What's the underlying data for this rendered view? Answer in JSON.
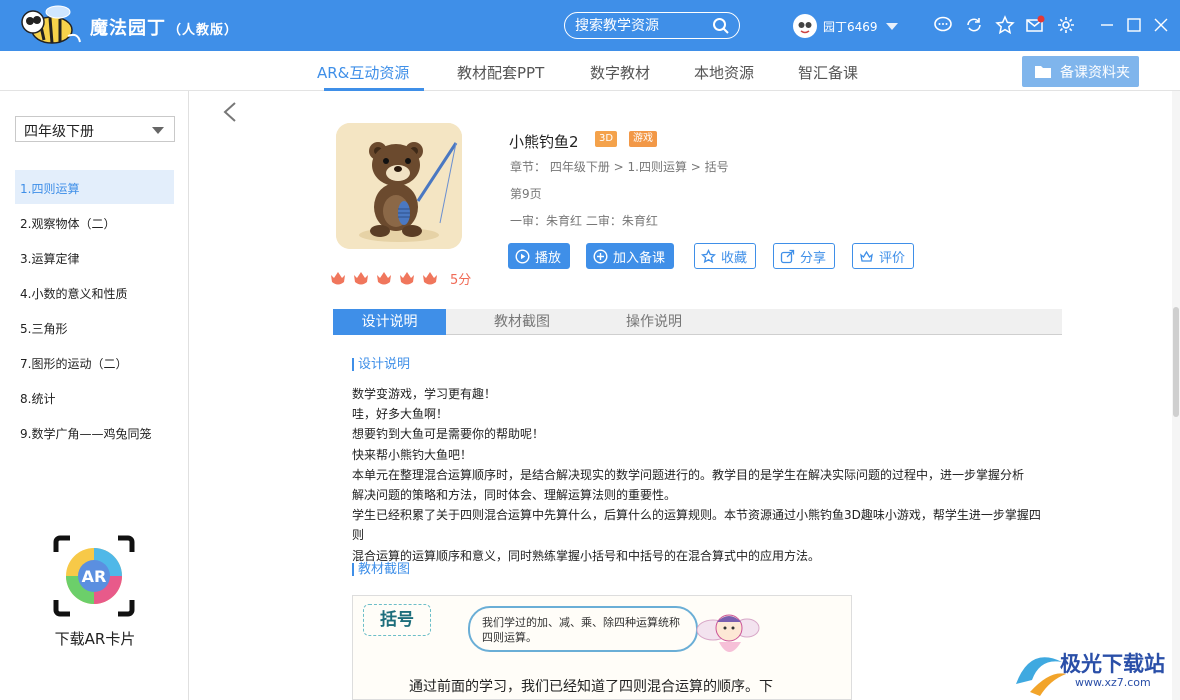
{
  "app": {
    "title": "魔法园丁",
    "edition": "（人教版）"
  },
  "search": {
    "placeholder": "搜索教学资源"
  },
  "user": {
    "name": "园丁6469"
  },
  "colors": {
    "primary": "#3f8fe8",
    "badge_orange": "#f4a24b",
    "score_red": "#f06b57"
  },
  "topnav": {
    "tabs": [
      {
        "label": "AR&互动资源",
        "active": true
      },
      {
        "label": "教材配套PPT",
        "active": false
      },
      {
        "label": "数字教材",
        "active": false
      },
      {
        "label": "本地资源",
        "active": false
      },
      {
        "label": "智汇备课",
        "active": false
      }
    ],
    "folder_button": "备课资料夹"
  },
  "sidebar": {
    "grade": "四年级下册",
    "units": [
      {
        "label": "1.四则运算",
        "active": true
      },
      {
        "label": "2.观察物体（二）",
        "active": false
      },
      {
        "label": "3.运算定律",
        "active": false
      },
      {
        "label": "4.小数的意义和性质",
        "active": false
      },
      {
        "label": "5.三角形",
        "active": false
      },
      {
        "label": "7.图形的运动（二）",
        "active": false
      },
      {
        "label": "8.统计",
        "active": false
      },
      {
        "label": "9.数学广角——鸡兔同笼",
        "active": false
      }
    ],
    "ar_card_label": "下载AR卡片",
    "ar_card_text": "AR"
  },
  "resource": {
    "title": "小熊钓鱼2",
    "badges": [
      "3D",
      "游戏"
    ],
    "chapter": "章节：   四年级下册 > 1.四则运算 > 括号",
    "page": "第9页",
    "review": "一审：朱育红      二审：朱育红",
    "rating_stars": 5,
    "score": "5分",
    "actions": {
      "play": "播放",
      "add": "加入备课",
      "favorite": "收藏",
      "share": "分享",
      "review": "评价"
    }
  },
  "detail_tabs": [
    {
      "label": "设计说明",
      "active": true
    },
    {
      "label": "教材截图",
      "active": false
    },
    {
      "label": "操作说明",
      "active": false
    }
  ],
  "design": {
    "heading": "设计说明",
    "lines": [
      "数学变游戏，学习更有趣！",
      "哇，好多大鱼啊！",
      "想要钓到大鱼可是需要你的帮助呢！",
      "快来帮小熊钓大鱼吧！",
      "本单元在整理混合运算顺序时，是结合解决现实的数学问题进行的。教学目的是学生在解决实际问题的过程中，进一步掌握分析",
      "解决问题的策略和方法，同时体会、理解运算法则的重要性。",
      "学生已经积累了关于四则混合运算中先算什么，后算什么的运算规则。本节资源通过小熊钓鱼3D趣味小游戏，帮学生进一步掌握四则",
      "混合运算的运算顺序和意义，同时熟练掌握小括号和中括号的在混合算式中的应用方法。"
    ]
  },
  "textbook": {
    "heading": "教材截图",
    "tag": "括号",
    "bubble": "我们学过的加、减、乘、除四种运算统称四则运算。",
    "body_line": "通过前面的学习，我们已经知道了四则混合运算的顺序。下"
  },
  "watermark": {
    "title": "极光下载站",
    "url": "www.xz7.com"
  }
}
